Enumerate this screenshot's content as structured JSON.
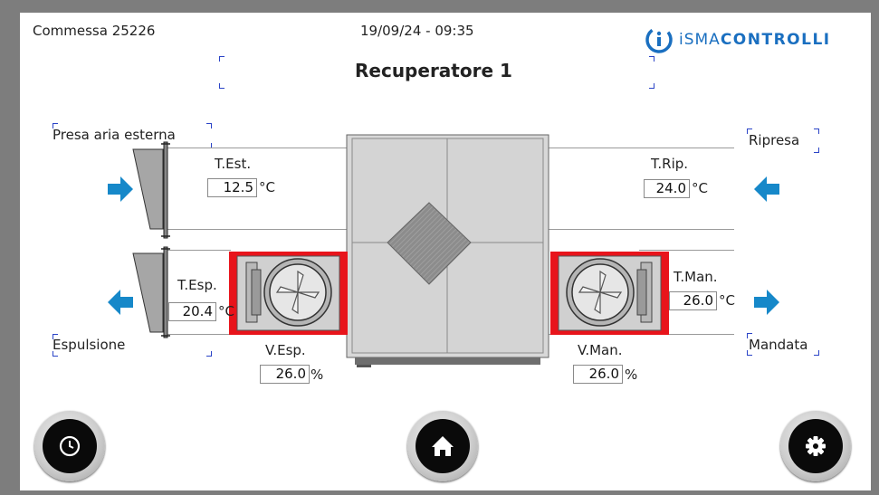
{
  "header": {
    "job": "Commessa 25226",
    "datetime": "19/09/24 - 09:35",
    "title": "Recuperatore 1",
    "logo_prefix": "iSMA",
    "logo_suffix": "CONTROLLI"
  },
  "labels": {
    "outdoor_air": "Presa aria esterna",
    "exhaust": "Espulsione",
    "return_air": "Ripresa",
    "supply": "Mandata"
  },
  "sensors": {
    "t_est": {
      "label": "T.Est.",
      "value": "12.5",
      "unit": "°C"
    },
    "t_rip": {
      "label": "T.Rip.",
      "value": "24.0",
      "unit": "°C"
    },
    "t_esp": {
      "label": "T.Esp.",
      "value": "20.4",
      "unit": "°C"
    },
    "t_man": {
      "label": "T.Man.",
      "value": "26.0",
      "unit": "°C"
    },
    "v_esp": {
      "label": "V.Esp.",
      "value": "26.0",
      "unit": "%"
    },
    "v_man": {
      "label": "V.Man.",
      "value": "26.0",
      "unit": "%"
    }
  },
  "nav": {
    "left_icon": "clock-icon",
    "center_icon": "home-icon",
    "right_icon": "gear-icon"
  },
  "colors": {
    "accent_blue": "#1688c9",
    "fan_red": "#e8141b",
    "logo_blue": "#1a6fc0"
  }
}
